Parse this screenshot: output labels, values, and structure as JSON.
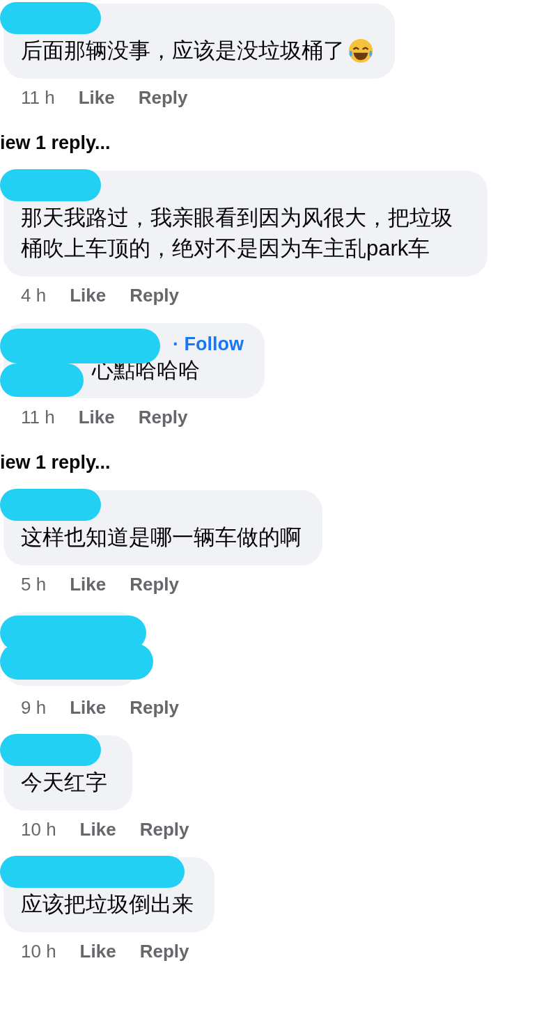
{
  "comments": [
    {
      "kind": "name",
      "text": "后面那辆没事，应该是没垃圾桶了",
      "emoji": true,
      "time": "11 h",
      "like": "Like",
      "reply": "Reply",
      "replies_link": "iew 1 reply..."
    },
    {
      "kind": "name",
      "text": "那天我路过，我亲眼看到因为风很大，把垃圾桶吹上车顶的，绝对不是因为车主乱park车",
      "time": "4 h",
      "like": "Like",
      "reply": "Reply"
    },
    {
      "kind": "nametext",
      "follow": "· Follow",
      "text": "心點哈哈哈",
      "time": "11 h",
      "like": "Like",
      "reply": "Reply",
      "replies_link": "iew 1 reply..."
    },
    {
      "kind": "name",
      "text": "这样也知道是哪一辆车做的啊",
      "time": "5 h",
      "like": "Like",
      "reply": "Reply"
    },
    {
      "kind": "hidden",
      "time": "9 h",
      "like": "Like",
      "reply": "Reply"
    },
    {
      "kind": "name",
      "text": "今天红字",
      "time": "10 h",
      "like": "Like",
      "reply": "Reply"
    },
    {
      "kind": "longname",
      "text": "应该把垃圾倒出来",
      "time": "10 h",
      "like": "Like",
      "reply": "Reply"
    }
  ]
}
